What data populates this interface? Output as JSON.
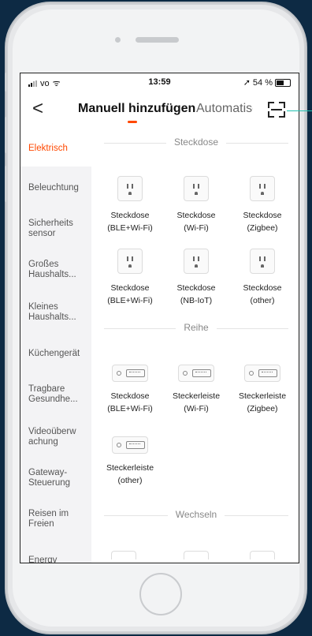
{
  "status_bar": {
    "carrier": "vo",
    "time": "13:59",
    "battery": "54 %"
  },
  "header": {
    "back_label": "<",
    "tab_manual": "Manuell hinzufügen",
    "tab_auto": "Automatisch"
  },
  "sidebar": {
    "items": [
      {
        "label": "Elektrisch",
        "active": true
      },
      {
        "label": "Beleuchtung",
        "active": false
      },
      {
        "label": "Sicherheits sensor",
        "active": false
      },
      {
        "label": "Großes Haushalts...",
        "active": false
      },
      {
        "label": "Kleines Haushalts...",
        "active": false
      },
      {
        "label": "Küchengerät",
        "active": false
      },
      {
        "label": "Tragbare Gesundhe...",
        "active": false
      },
      {
        "label": "Videoüberw achung",
        "active": false
      },
      {
        "label": "Gateway-Steuerung",
        "active": false
      },
      {
        "label": "Reisen im Freien",
        "active": false
      },
      {
        "label": "Energy",
        "active": false
      }
    ]
  },
  "sections": {
    "steckdose": {
      "title": "Steckdose",
      "items": [
        {
          "line1": "Steckdose",
          "line2": "(BLE+Wi-Fi)"
        },
        {
          "line1": "Steckdose",
          "line2": "(Wi-Fi)"
        },
        {
          "line1": "Steckdose",
          "line2": "(Zigbee)"
        },
        {
          "line1": "Steckdose",
          "line2": "(BLE+Wi-Fi)"
        },
        {
          "line1": "Steckdose",
          "line2": "(NB-IoT)"
        },
        {
          "line1": "Steckdose",
          "line2": "(other)"
        }
      ]
    },
    "reihe": {
      "title": "Reihe",
      "items": [
        {
          "line1": "Steckdose",
          "line2": "(BLE+Wi-Fi)"
        },
        {
          "line1": "Steckerleiste",
          "line2": "(Wi-Fi)"
        },
        {
          "line1": "Steckerleiste",
          "line2": "(Zigbee)"
        },
        {
          "line1": "Steckerleiste",
          "line2": "(other)"
        }
      ]
    },
    "wechseln": {
      "title": "Wechseln"
    }
  },
  "colors": {
    "accent": "#ff4800",
    "annotation": "#20c0b0"
  },
  "icons": {
    "back": "chevron-left-icon",
    "scan": "scan-icon",
    "socket": "socket-icon",
    "power_strip": "power-strip-icon"
  }
}
